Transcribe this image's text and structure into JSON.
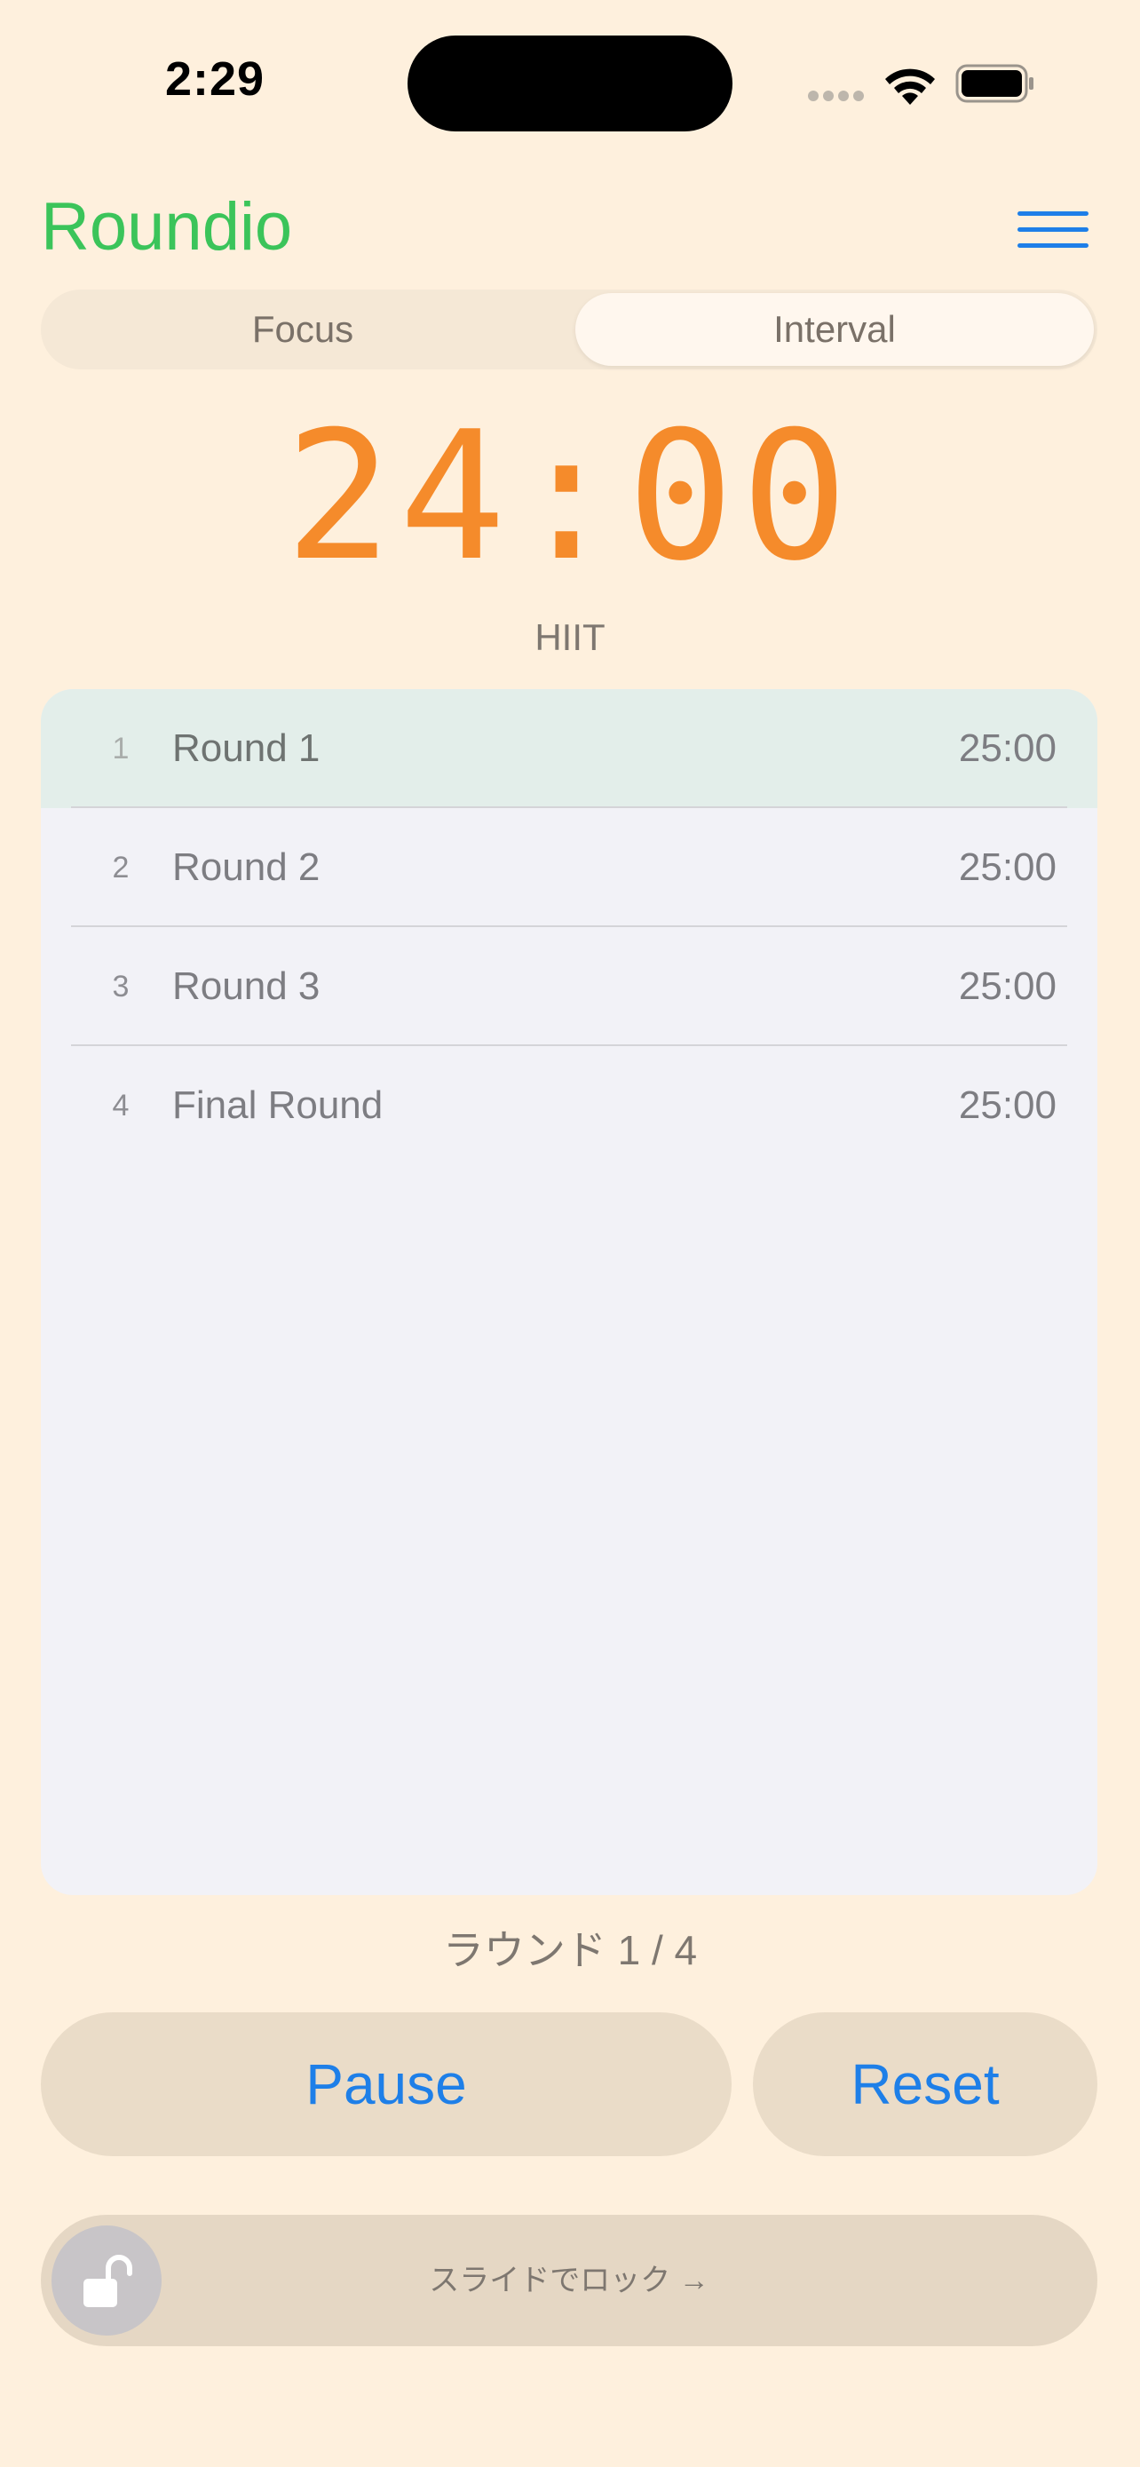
{
  "status_bar": {
    "time": "2:29"
  },
  "header": {
    "title": "Roundio",
    "menu_icon": "hamburger-menu-icon"
  },
  "mode_tabs": [
    {
      "label": "Focus",
      "selected": false
    },
    {
      "label": "Interval",
      "selected": true
    }
  ],
  "timer": {
    "display": "24:00",
    "preset": "HIIT"
  },
  "rounds": [
    {
      "index": "1",
      "name": "Round 1",
      "duration": "25:00",
      "active": true
    },
    {
      "index": "2",
      "name": "Round 2",
      "duration": "25:00",
      "active": false
    },
    {
      "index": "3",
      "name": "Round 3",
      "duration": "25:00",
      "active": false
    },
    {
      "index": "4",
      "name": "Final Round",
      "duration": "25:00",
      "active": false
    }
  ],
  "progress_text": "ラウンド 1 / 4",
  "controls": {
    "pause_label": "Pause",
    "reset_label": "Reset"
  },
  "slide_lock": {
    "label": "スライドでロック →",
    "knob_icon": "unlock-icon"
  },
  "colors": {
    "background": "#FEF0DD",
    "title_green": "#3BC45A",
    "accent_blue": "#1E7FE8",
    "timer_orange": "#F58B2B"
  }
}
